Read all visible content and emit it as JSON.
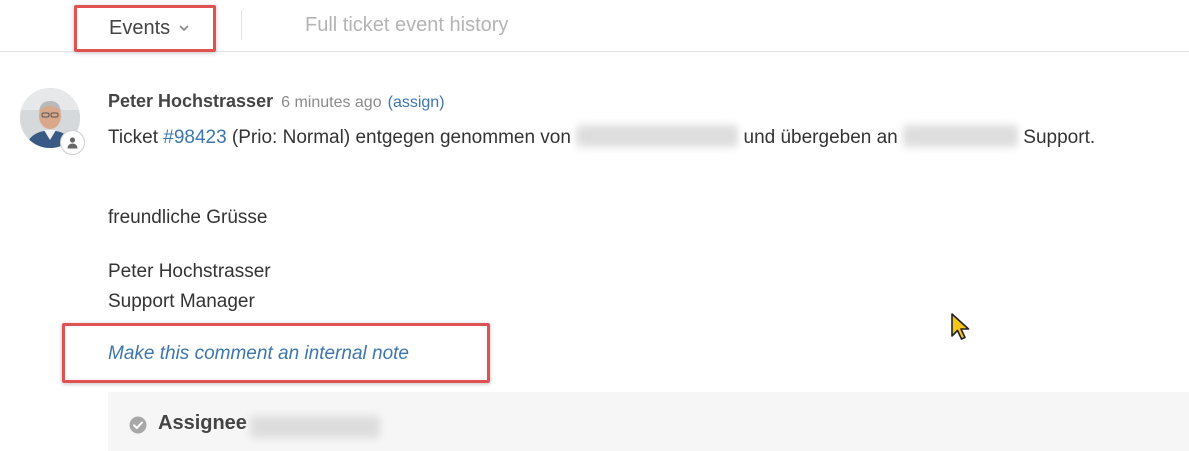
{
  "tabs": {
    "events_label": "Events",
    "full_history_label": "Full ticket event history"
  },
  "comment": {
    "author": "Peter Hochstrasser",
    "time": "6 minutes ago",
    "assign_label": "(assign)",
    "line1": {
      "prefix": "Ticket ",
      "ticket_link": "#98423",
      "middle": " (Prio: Normal) entgegen genommen von ",
      "redacted_1": "Thomas Zehetner",
      "middle2": " und übergeben an ",
      "redacted_2": "AXON by IT",
      "suffix": " Support."
    },
    "greeting": "freundliche Grüsse",
    "signature_name": "Peter Hochstrasser",
    "signature_title": "Support Manager",
    "internal_note_link": "Make this comment an internal note"
  },
  "event": {
    "label": "Assignee",
    "redacted_value": "Felix Wüthrich"
  },
  "icons": {
    "dropdown": "chevron-down-icon",
    "avatar_badge": "user-icon",
    "event_status": "check-circle-icon",
    "cursor": "mouse-pointer-icon"
  },
  "colors": {
    "link": "#3d76ae",
    "highlight_border": "#e05252",
    "muted_text": "#b4b4b4",
    "cursor_fill": "#f5c518"
  }
}
